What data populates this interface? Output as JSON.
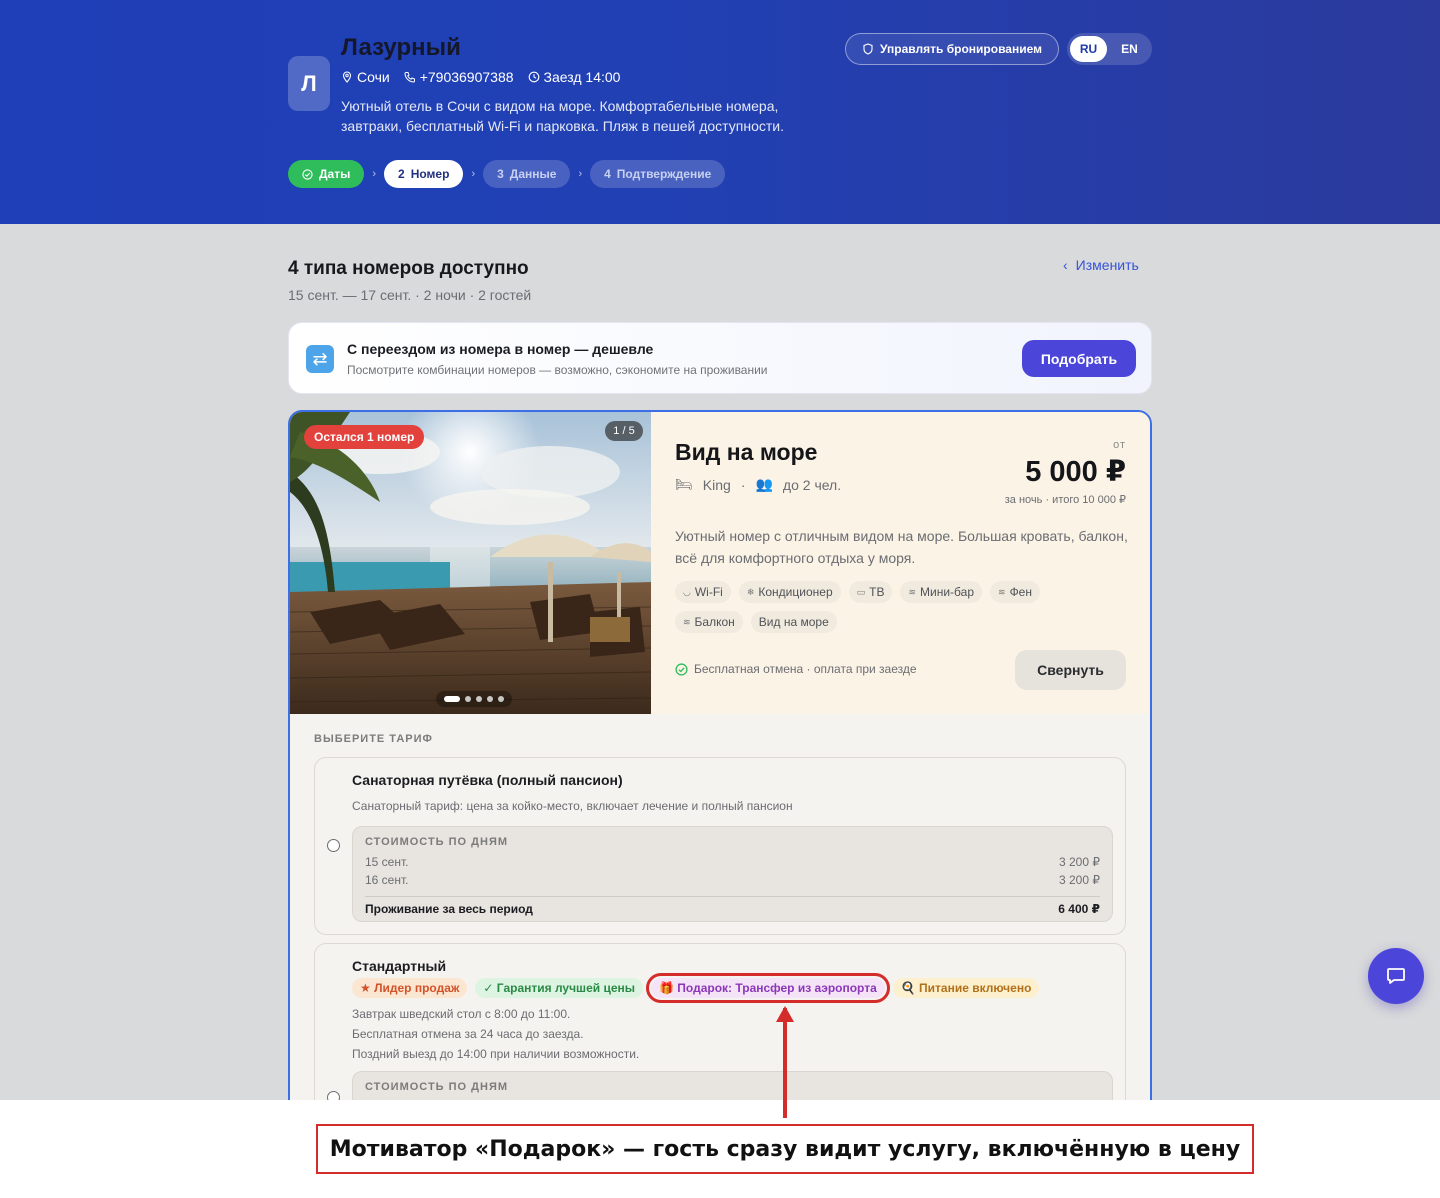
{
  "hotel": {
    "logo_letter": "Л",
    "name": "Лазурный",
    "city": "Сочи",
    "phone": "+79036907388",
    "checkin": "Заезд 14:00",
    "description": "Уютный отель в Сочи с видом на море. Комфортабельные номера, завтраки, бесплатный Wi-Fi и парковка. Пляж в пешей доступности."
  },
  "header": {
    "manage_label": "Управлять бронированием",
    "languages": [
      "RU",
      "EN"
    ],
    "active_language": "RU"
  },
  "steps": [
    {
      "num": "",
      "label": "Даты",
      "state": "done"
    },
    {
      "num": "2",
      "label": "Номер",
      "state": "current"
    },
    {
      "num": "3",
      "label": "Данные",
      "state": "pending"
    },
    {
      "num": "4",
      "label": "Подтверждение",
      "state": "pending"
    }
  ],
  "results": {
    "title": "4 типа номеров доступно",
    "subtitle": "15 сент. — 17 сент. · 2 ночи · 2 гостей",
    "edit_label": "Изменить"
  },
  "banner": {
    "title": "С переездом из номера в номер — дешевле",
    "subtitle": "Посмотрите комбинации номеров — возможно, сэкономите на проживании",
    "button": "Подобрать"
  },
  "room": {
    "badge": "Остался 1 номер",
    "photo_counter": "1 / 5",
    "photo_total": 5,
    "photo_index": 1,
    "name": "Вид на море",
    "bed": "King",
    "guests": "до 2 чел.",
    "price_from": "от",
    "price": "5 000 ₽",
    "price_note": "за ночь · итого 10 000 ₽",
    "description": "Уютный номер с отличным видом на море. Большая кровать, балкон, всё для комфортного отдыха у моря.",
    "amenities": [
      "Wi-Fi",
      "Кондиционер",
      "ТВ",
      "Мини-бар",
      "Фен",
      "Балкон",
      "Вид на море"
    ],
    "cancel_note": "Бесплатная отмена · оплата при заезде",
    "collapse_label": "Свернуть"
  },
  "tariffs": {
    "heading": "ВЫБЕРИТЕ ТАРИФ",
    "items": [
      {
        "name": "Санаторная путёвка (полный пансион)",
        "description": "Санаторный тариф: цена за койко-место, включает лечение и полный пансион",
        "breakdown_title": "СТОИМОСТЬ ПО ДНЯМ",
        "days": [
          {
            "date": "15 сент.",
            "price": "3 200 ₽"
          },
          {
            "date": "16 сент.",
            "price": "3 200 ₽"
          }
        ],
        "total_label": "Проживание за весь период",
        "total": "6 400 ₽"
      },
      {
        "name": "Стандартный",
        "tags": [
          "★ Лидер продаж",
          "✓ Гарантия лучшей цены",
          "🎁 Подарок: Трансфер из аэропорта",
          "🍳 Питание включено"
        ],
        "description_lines": [
          "Завтрак шведский стол с 8:00 до 11:00.",
          "Бесплатная отмена за 24 часа до заезда.",
          "Поздний выезд до 14:00 при наличии возможности."
        ],
        "breakdown_title": "СТОИМОСТЬ ПО ДНЯМ"
      }
    ]
  },
  "annotation": {
    "callout": "Мотиватор «Подарок» — гость сразу видит услугу, включённую в цену",
    "color": "#d42b2b"
  },
  "colors": {
    "accent": "#4b45da",
    "hero": "#1f3fb8",
    "success": "#2fbd5c",
    "danger": "#e2413c"
  }
}
